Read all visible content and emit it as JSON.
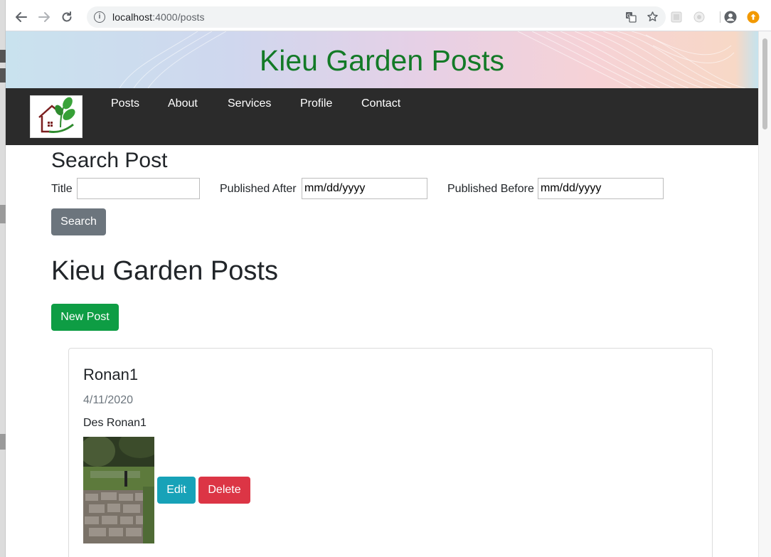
{
  "browser": {
    "url_host": "localhost",
    "url_path": ":4000/posts",
    "icons": [
      "back-arrow-icon",
      "forward-arrow-icon",
      "reload-icon",
      "info-icon",
      "translate-icon",
      "star-icon",
      "extension-icon",
      "extension-icon",
      "profile-icon",
      "update-icon"
    ]
  },
  "banner": {
    "title": "Kieu Garden Posts",
    "title_color": "#137a27"
  },
  "nav": {
    "items": [
      {
        "label": "Posts"
      },
      {
        "label": "About"
      },
      {
        "label": "Services"
      },
      {
        "label": "Profile"
      },
      {
        "label": "Contact"
      }
    ]
  },
  "search": {
    "heading": "Search Post",
    "title_label": "Title",
    "title_value": "",
    "after_label": "Published After",
    "after_value": "mm/dd/yyyy",
    "before_label": "Published Before",
    "before_value": "mm/dd/yyyy",
    "button_label": "Search"
  },
  "posts": {
    "heading": "Kieu Garden Posts",
    "new_button_label": "New Post",
    "items": [
      {
        "title": "Ronan1",
        "date": "4/11/2020",
        "description": "Des Ronan1",
        "edit_label": "Edit",
        "delete_label": "Delete"
      }
    ]
  },
  "colors": {
    "navbar": "#2b2b2b",
    "secondary": "#6c757d",
    "success": "#0e9d44",
    "info": "#17a2b8",
    "danger": "#dc3545"
  }
}
